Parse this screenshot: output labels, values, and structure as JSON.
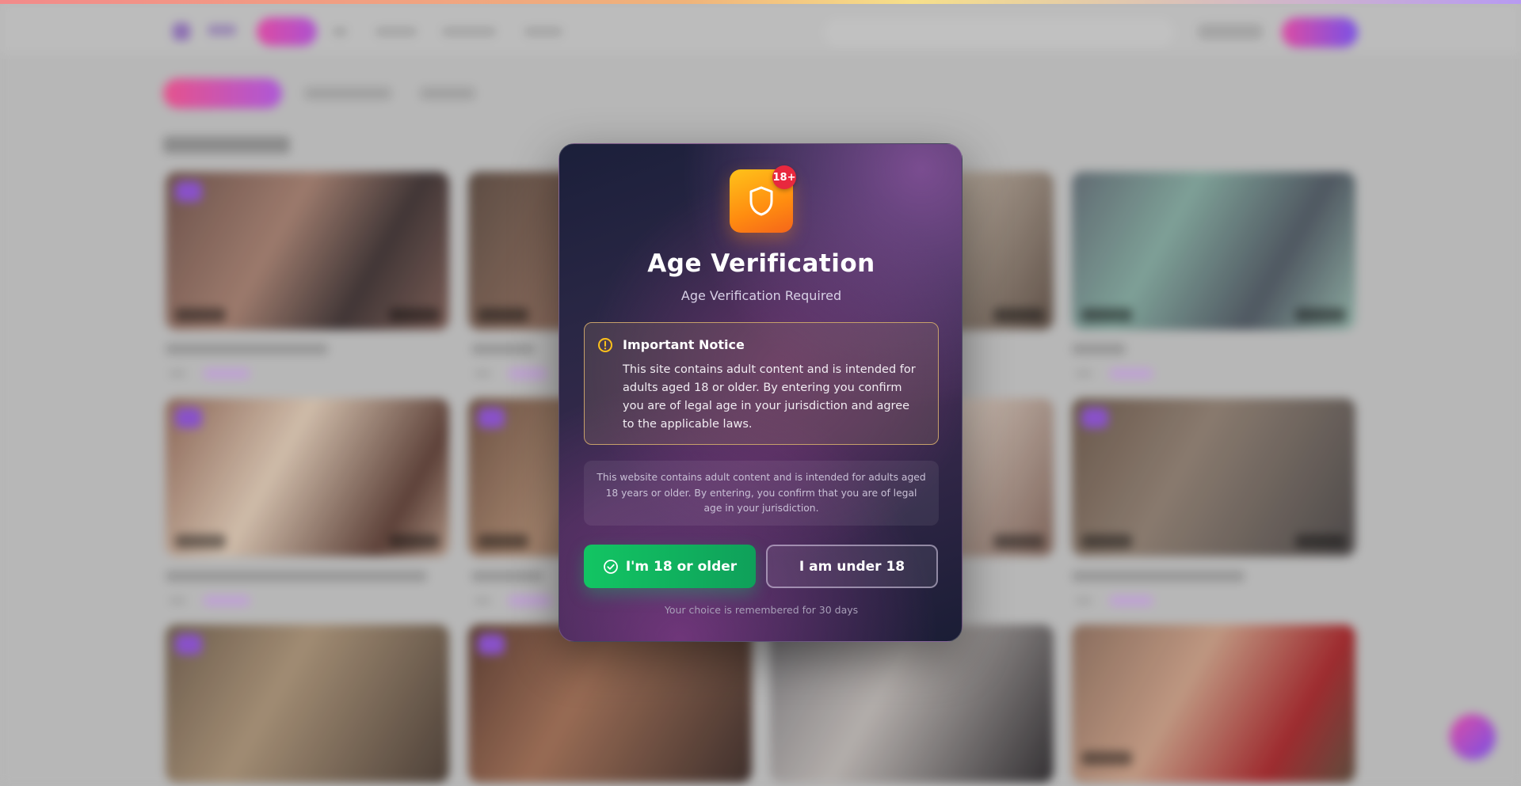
{
  "modal": {
    "badge": "18+",
    "title": "Age Verification",
    "subtitle": "Age Verification Required",
    "notice": {
      "title": "Important Notice",
      "body": "This site contains adult content and is intended for adults aged 18 or older. By entering you confirm you are of legal age in your jurisdiction and agree to the applicable laws."
    },
    "info": "This website contains adult content and is intended for adults aged 18 years or older. By entering, you confirm that you are of legal age in your jurisdiction.",
    "confirm_button": "I'm 18 or older",
    "deny_button": "I am under 18",
    "remember_note": "Your choice is remembered for 30 days"
  },
  "icons": {
    "shield": "shield-icon",
    "notice": "alert-circle-icon",
    "confirm": "check-circle-icon"
  },
  "colors": {
    "confirm_green": "#12c563",
    "badge_red": "#e8283e",
    "shield_orange": "#ff8c10",
    "accent_pink": "#e548a8",
    "accent_purple": "#7b4ff0"
  }
}
